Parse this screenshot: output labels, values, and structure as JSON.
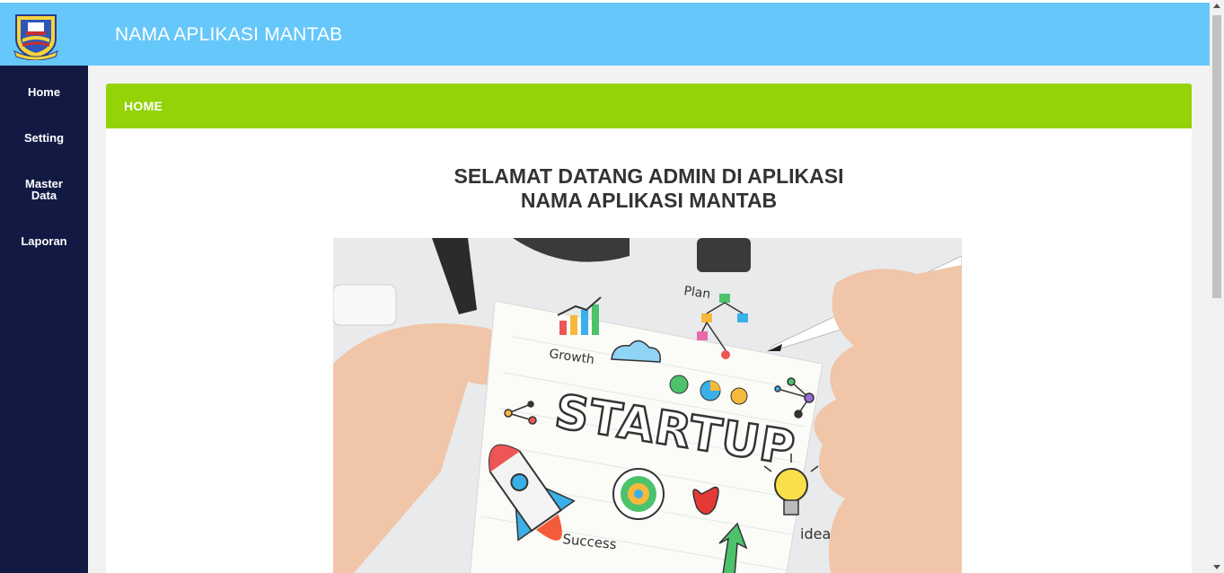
{
  "header": {
    "app_title": "NAMA APLIKASI MANTAB",
    "logo_icon": "regional-emblem-icon",
    "background_color": "#66c7fa"
  },
  "sidebar": {
    "background_color": "#121a44",
    "items": [
      {
        "label": "Home"
      },
      {
        "label": "Setting"
      },
      {
        "label_lines": [
          "Master",
          "Data"
        ]
      },
      {
        "label": "Laporan"
      }
    ]
  },
  "card": {
    "title": "HOME",
    "header_color": "#94d307",
    "welcome_line1": "SELAMAT DATANG ADMIN DI APLIKASI",
    "welcome_line2": "NAMA APLIKASI MANTAB"
  },
  "banner": {
    "title": "STARTUP",
    "labels": {
      "plan": "Plan",
      "growth": "Growth",
      "success": "Success",
      "idea": "idea"
    }
  }
}
